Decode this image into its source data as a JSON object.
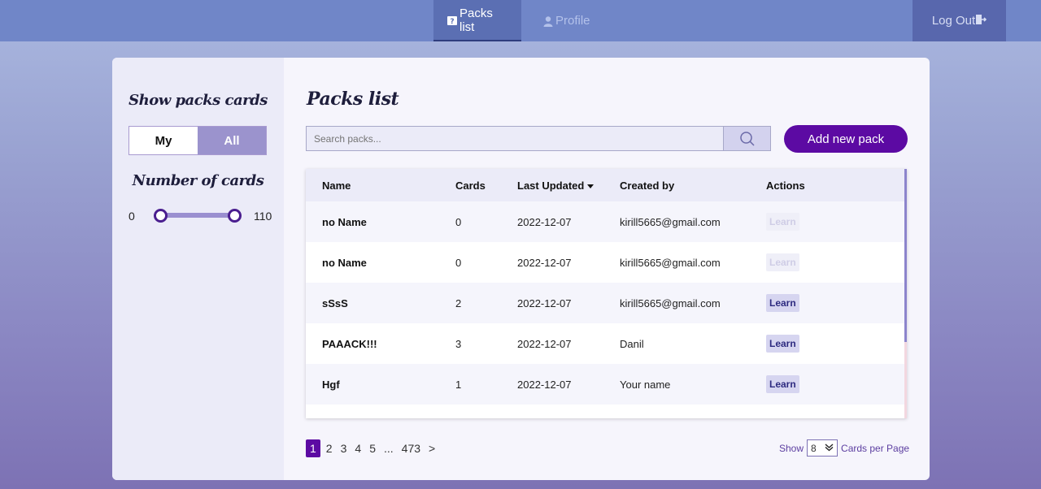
{
  "nav": {
    "packs_label": "Packs list",
    "profile_label": "Profile",
    "logout_label": "Log Out"
  },
  "sidebar": {
    "show_title": "Show packs cards",
    "toggle_my": "My",
    "toggle_all": "All",
    "number_title": "Number of cards",
    "range_min": "0",
    "range_max": "110",
    "range_value_low": 0,
    "range_value_high": 110
  },
  "main": {
    "title": "Packs list",
    "search_placeholder": "Search packs...",
    "add_button": "Add new pack"
  },
  "table": {
    "headers": {
      "name": "Name",
      "cards": "Cards",
      "updated": "Last Updated",
      "created_by": "Created by",
      "actions": "Actions"
    },
    "rows": [
      {
        "name": "no Name",
        "cards": "0",
        "updated": "2022-12-07",
        "created_by": "kirill5665@gmail.com",
        "action": "Learn",
        "disabled": true
      },
      {
        "name": "no Name",
        "cards": "0",
        "updated": "2022-12-07",
        "created_by": "kirill5665@gmail.com",
        "action": "Learn",
        "disabled": true
      },
      {
        "name": "sSsS",
        "cards": "2",
        "updated": "2022-12-07",
        "created_by": "kirill5665@gmail.com",
        "action": "Learn",
        "disabled": false
      },
      {
        "name": "PAAACK!!!",
        "cards": "3",
        "updated": "2022-12-07",
        "created_by": "Danil",
        "action": "Learn",
        "disabled": false
      },
      {
        "name": "Hgf",
        "cards": "1",
        "updated": "2022-12-07",
        "created_by": "Your name",
        "action": "Learn",
        "disabled": false
      }
    ]
  },
  "pagination": {
    "pages": [
      "1",
      "2",
      "3",
      "4",
      "5",
      "...",
      "473",
      ">"
    ],
    "current": "1",
    "show_label": "Show",
    "per_page_value": "8",
    "per_page_label": "Cards per Page"
  },
  "colors": {
    "accent": "#5c0aa3",
    "topbar": "#7086c8"
  }
}
